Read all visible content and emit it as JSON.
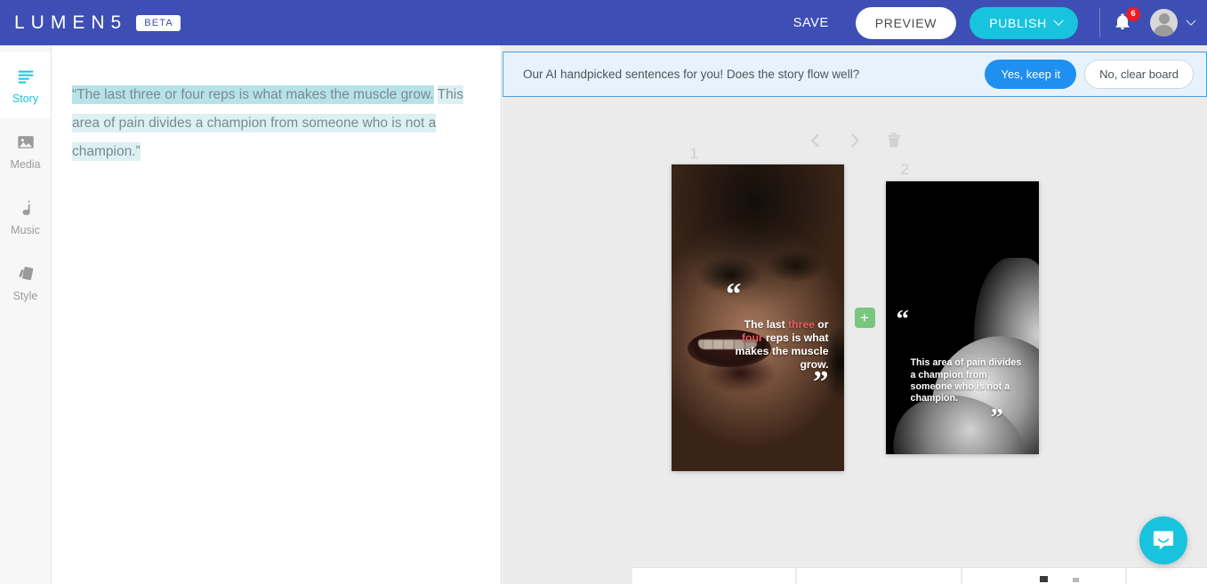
{
  "topbar": {
    "logo": "LUMEN5",
    "beta_badge": "BETA",
    "save_label": "SAVE",
    "preview_label": "PREVIEW",
    "publish_label": "PUBLISH",
    "notification_count": "6",
    "brand_color": "#3d4fb4",
    "publish_color": "#18c4dd",
    "badge_color": "#ed1c24"
  },
  "sidebar": {
    "items": [
      {
        "label": "Story",
        "icon": "story-lines-icon",
        "active": true
      },
      {
        "label": "Media",
        "icon": "image-icon",
        "active": false
      },
      {
        "label": "Music",
        "icon": "music-note-icon",
        "active": false
      },
      {
        "label": "Style",
        "icon": "style-cards-icon",
        "active": false
      }
    ],
    "active_color": "#18c4dd",
    "inactive_color": "#9b9b9b"
  },
  "script": {
    "segment_1": "“The last three or four reps is what makes the muscle grow.",
    "segment_2": "This area of pain divides a champion from someone who is not a champion.”",
    "highlight_strong": "#b6e3e8",
    "highlight_light": "#ddf0f3"
  },
  "ai_banner": {
    "message": "Our AI handpicked sentences for you! Does the story flow well?",
    "confirm_label": "Yes, keep it",
    "dismiss_label": "No, clear board",
    "background": "#e6f3fc",
    "border_color": "#4a9fe0",
    "confirm_color": "#1f8ff0"
  },
  "board": {
    "toolbar": {
      "prev_icon": "chevron-left-icon",
      "next_icon": "chevron-right-icon",
      "delete_icon": "trash-icon"
    },
    "add_scene_label": "+",
    "add_scene_color": "#7ac67f",
    "cards": [
      {
        "number": "1",
        "quote_prefix": "The last ",
        "accent_1": "three",
        "quote_mid": " or ",
        "accent_2": "four",
        "quote_suffix": " reps is what makes the muscle grow.",
        "open_quote": "“",
        "close_quote": "”",
        "accent_color": "#ea5a63"
      },
      {
        "number": "2",
        "quote_full": "This area of pain divides a champion from someone who is not a champion.",
        "open_quote": "“",
        "close_quote": "”"
      }
    ]
  },
  "chat": {
    "icon": "chat-bubble-icon",
    "color": "#18c4dd"
  }
}
